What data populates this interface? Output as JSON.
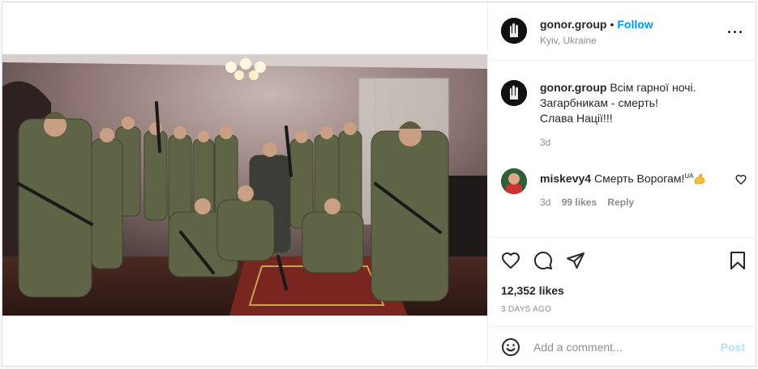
{
  "post": {
    "username": "gonor.group",
    "follow_label": "Follow",
    "location": "Kyiv, Ukraine",
    "caption": {
      "username": "gonor.group",
      "lines": [
        "Всім гарної ночі.",
        "Загарбникам - смерть!",
        "Слава Нації!!!"
      ],
      "time": "3d"
    },
    "comments": [
      {
        "username": "miskevy4",
        "text": "Смерть Ворогам!",
        "flag": "UA",
        "emoji": "💪",
        "time": "3d",
        "likes": "99 likes",
        "reply_label": "Reply"
      }
    ],
    "likes": "12,352 likes",
    "date": "3 DAYS AGO",
    "add_comment": {
      "placeholder": "Add a comment...",
      "post_label": "Post"
    },
    "icons": {
      "options": "more-options-icon",
      "like": "heart-icon",
      "comment": "comment-bubble-icon",
      "share": "paper-plane-icon",
      "save": "bookmark-icon",
      "emoji": "smiley-icon",
      "comment_like": "small-heart-icon"
    },
    "colors": {
      "link": "#0095f6",
      "text": "#262626",
      "secondary": "#8e8e8e",
      "post_disabled": "#b2dffc",
      "border": "#dbdbdb"
    }
  }
}
